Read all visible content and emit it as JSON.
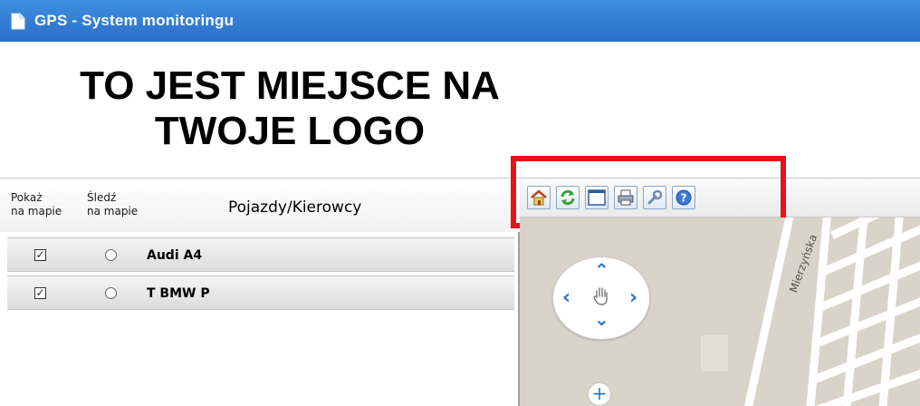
{
  "window": {
    "title": "GPS - System monitoringu"
  },
  "logo": {
    "line1": "TO JEST MIEJSCE NA",
    "line2": "TWOJE LOGO"
  },
  "table_header": {
    "show_line1": "Pokaż",
    "show_line2": "na mapie",
    "follow_line1": "Śledź",
    "follow_line2": "na mapie",
    "title": "Pojazdy/Kierowcy"
  },
  "vehicles": [
    {
      "name": "Audi A4",
      "show_checked": true,
      "follow_selected": false
    },
    {
      "name": "T BMW P",
      "show_checked": true,
      "follow_selected": false
    }
  ],
  "toolbar": {
    "icons": [
      "home-icon",
      "refresh-icon",
      "window-icon",
      "print-icon",
      "wrench-icon",
      "help-icon"
    ]
  },
  "map": {
    "street_label": "Mierzyńska",
    "zoom_in_label": "+"
  },
  "colors": {
    "titlebar": "#2b6fc9",
    "highlight": "#e8121b",
    "map_bg": "#d9d4c9",
    "control_blue": "#2a6fd6"
  }
}
